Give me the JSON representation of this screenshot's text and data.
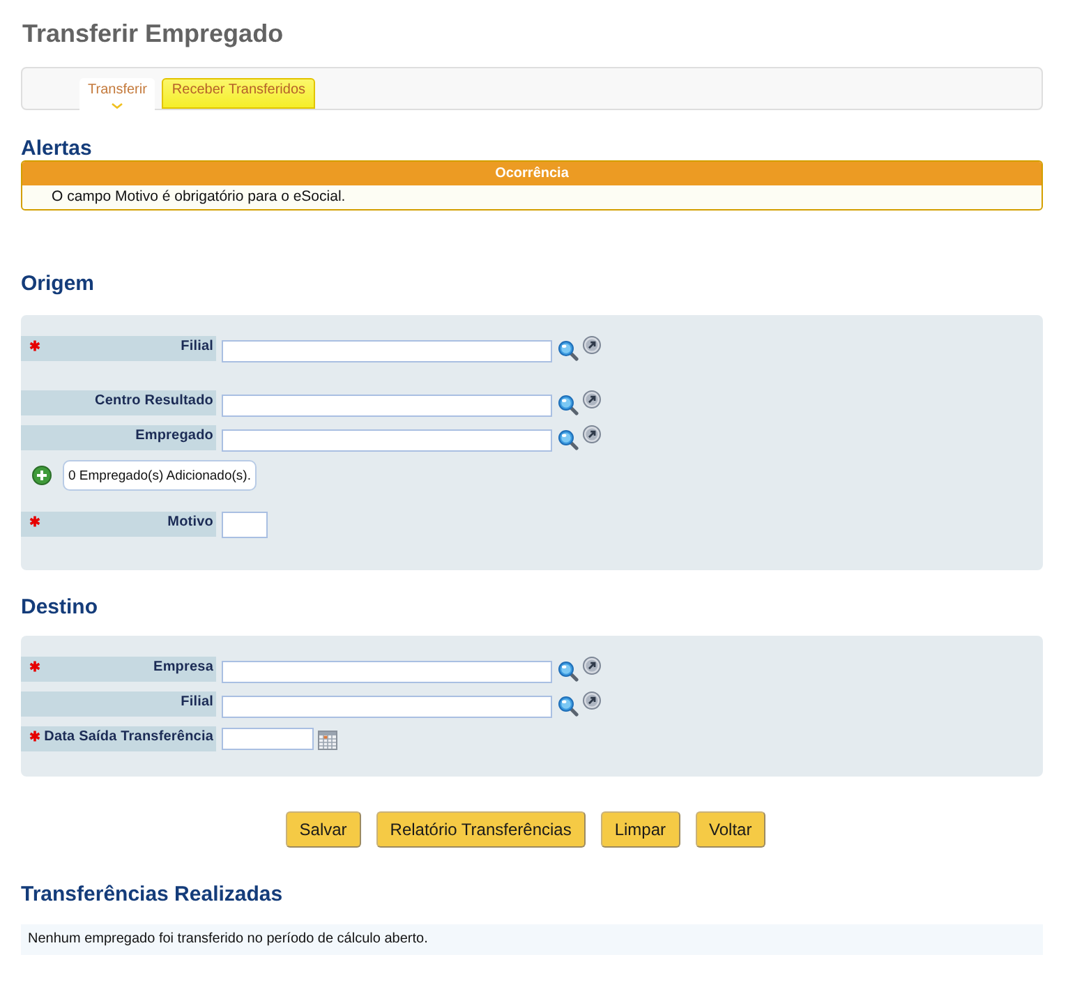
{
  "page": {
    "title": "Transferir Empregado"
  },
  "tabs": [
    {
      "label": "Transferir",
      "selected": true
    },
    {
      "label": "Receber Transferidos",
      "selected": false
    }
  ],
  "alerts": {
    "title": "Alertas",
    "column": "Ocorrência",
    "rows": [
      "O campo Motivo é obrigatório para o eSocial."
    ]
  },
  "sections": [
    {
      "title": "Origem",
      "fields": [
        {
          "kind": "lookup",
          "label": "Filial",
          "required": true
        },
        {
          "kind": "lookup",
          "label": "Centro Resultado",
          "required": false
        },
        {
          "kind": "lookup",
          "label": "Empregado",
          "required": false
        },
        {
          "kind": "counter",
          "text": "0 Empregado(s) Adicionado(s)."
        },
        {
          "kind": "short",
          "label": "Motivo",
          "required": true
        }
      ]
    },
    {
      "title": "Destino",
      "fields": [
        {
          "kind": "lookup",
          "label": "Empresa",
          "required": true
        },
        {
          "kind": "lookup",
          "label": "Filial",
          "required": false
        },
        {
          "kind": "date",
          "label": "Data Saída Transferência",
          "required": true
        }
      ]
    }
  ],
  "buttons": [
    "Salvar",
    "Relatório Transferências",
    "Limpar",
    "Voltar"
  ],
  "transfers": {
    "title": "Transferências Realizadas",
    "message": "Nenhum empregado foi transferido no período de cálculo aberto."
  }
}
